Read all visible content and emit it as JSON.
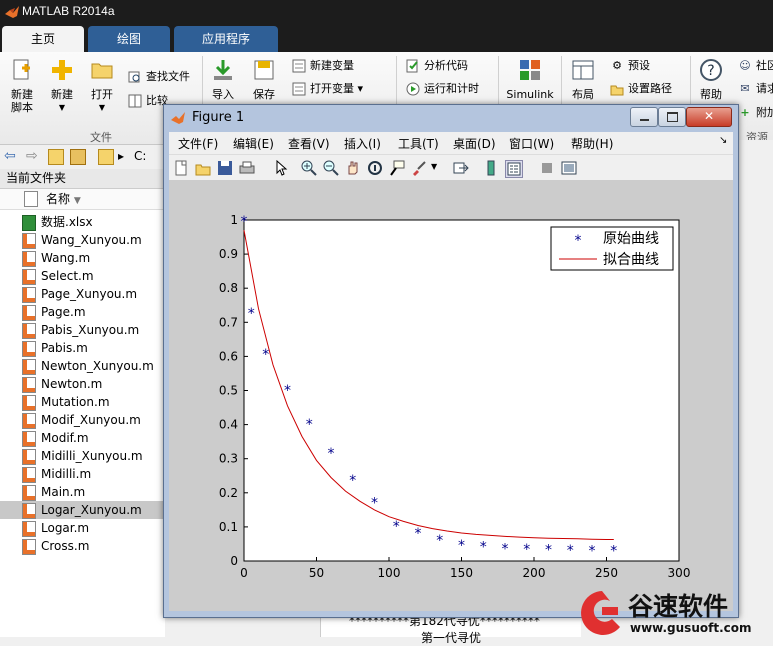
{
  "app": {
    "title": "MATLAB R2014a"
  },
  "tabs": [
    {
      "label": "主页",
      "active": true
    },
    {
      "label": "绘图",
      "active": false
    },
    {
      "label": "应用程序",
      "active": false
    }
  ],
  "ribbon": {
    "new_script": "新建\n脚本",
    "new": "新建",
    "open": "打开",
    "find_files": "查找文件",
    "compare": "比较",
    "import": "导入",
    "save": "保存",
    "new_variable": "新建变量",
    "open_variable": "打开变量",
    "analyze_code": "分析代码",
    "run_time": "运行和计时",
    "simulink": "Simulink",
    "layout": "布局",
    "preferences": "预设",
    "set_path": "设置路径",
    "help": "帮助",
    "community": "社区",
    "request": "请求",
    "addons": "附加",
    "group_file": "文件",
    "group_resources": "资源"
  },
  "address": {
    "path": "C:"
  },
  "left_panel": {
    "title": "当前文件夹",
    "column_name": "名称",
    "files": [
      {
        "name": "数据.xlsx",
        "type": "xlsx",
        "selected": false
      },
      {
        "name": "Wang_Xunyou.m",
        "type": "m",
        "selected": false
      },
      {
        "name": "Wang.m",
        "type": "m",
        "selected": false
      },
      {
        "name": "Select.m",
        "type": "m",
        "selected": false
      },
      {
        "name": "Page_Xunyou.m",
        "type": "m",
        "selected": false
      },
      {
        "name": "Page.m",
        "type": "m",
        "selected": false
      },
      {
        "name": "Pabis_Xunyou.m",
        "type": "m",
        "selected": false
      },
      {
        "name": "Pabis.m",
        "type": "m",
        "selected": false
      },
      {
        "name": "Newton_Xunyou.m",
        "type": "m",
        "selected": false
      },
      {
        "name": "Newton.m",
        "type": "m",
        "selected": false
      },
      {
        "name": "Mutation.m",
        "type": "m",
        "selected": false
      },
      {
        "name": "Modif_Xunyou.m",
        "type": "m",
        "selected": false
      },
      {
        "name": "Modif.m",
        "type": "m",
        "selected": false
      },
      {
        "name": "Midilli_Xunyou.m",
        "type": "m",
        "selected": false
      },
      {
        "name": "Midilli.m",
        "type": "m",
        "selected": false
      },
      {
        "name": "Main.m",
        "type": "m",
        "selected": false
      },
      {
        "name": "Logar_Xunyou.m",
        "type": "m",
        "selected": true
      },
      {
        "name": "Logar.m",
        "type": "m",
        "selected": false
      },
      {
        "name": "Cross.m",
        "type": "m",
        "selected": false
      }
    ]
  },
  "command_window": {
    "line1": "**********第182代寻优**********",
    "line2": "第一代寻优"
  },
  "figure": {
    "title": "Figure 1",
    "menu": [
      "文件(F)",
      "编辑(E)",
      "查看(V)",
      "插入(I)",
      "工具(T)",
      "桌面(D)",
      "窗口(W)",
      "帮助(H)"
    ]
  },
  "chart_data": {
    "type": "scatter",
    "title": "",
    "xlabel": "",
    "ylabel": "",
    "xlim": [
      0,
      300
    ],
    "ylim": [
      0,
      1
    ],
    "xticks": [
      0,
      50,
      100,
      150,
      200,
      250,
      300
    ],
    "yticks": [
      0,
      0.1,
      0.2,
      0.3,
      0.4,
      0.5,
      0.6,
      0.7,
      0.8,
      0.9,
      1
    ],
    "grid": false,
    "legend_position": "top-right",
    "series": [
      {
        "name": "原始曲线",
        "style": "marker-star",
        "color": "#00008b",
        "x": [
          0,
          5,
          15,
          30,
          45,
          60,
          75,
          90,
          105,
          120,
          135,
          150,
          165,
          180,
          195,
          210,
          225,
          240,
          255
        ],
        "y": [
          1.0,
          0.73,
          0.61,
          0.505,
          0.405,
          0.32,
          0.24,
          0.175,
          0.105,
          0.085,
          0.065,
          0.05,
          0.045,
          0.04,
          0.038,
          0.036,
          0.035,
          0.034,
          0.034
        ]
      },
      {
        "name": "拟合曲线",
        "style": "line",
        "color": "#cc0000",
        "x": [
          0,
          10,
          20,
          30,
          40,
          50,
          60,
          70,
          80,
          90,
          100,
          110,
          120,
          130,
          140,
          150,
          160,
          170,
          180,
          190,
          200,
          210,
          220,
          230,
          240,
          250,
          255
        ],
        "y": [
          0.97,
          0.74,
          0.575,
          0.455,
          0.365,
          0.295,
          0.245,
          0.205,
          0.175,
          0.15,
          0.13,
          0.116,
          0.104,
          0.095,
          0.088,
          0.082,
          0.078,
          0.075,
          0.072,
          0.07,
          0.068,
          0.067,
          0.066,
          0.065,
          0.064,
          0.063,
          0.063
        ]
      }
    ]
  },
  "watermark": {
    "brand": "谷速软件",
    "url": "www.gusuoft.com"
  },
  "colors": {
    "tab_blue": "#2f5f96",
    "titlebar": "#1c1c1c",
    "figure_frame": "#b4c5de",
    "marker": "#00008b",
    "fit_line": "#cc0000"
  }
}
